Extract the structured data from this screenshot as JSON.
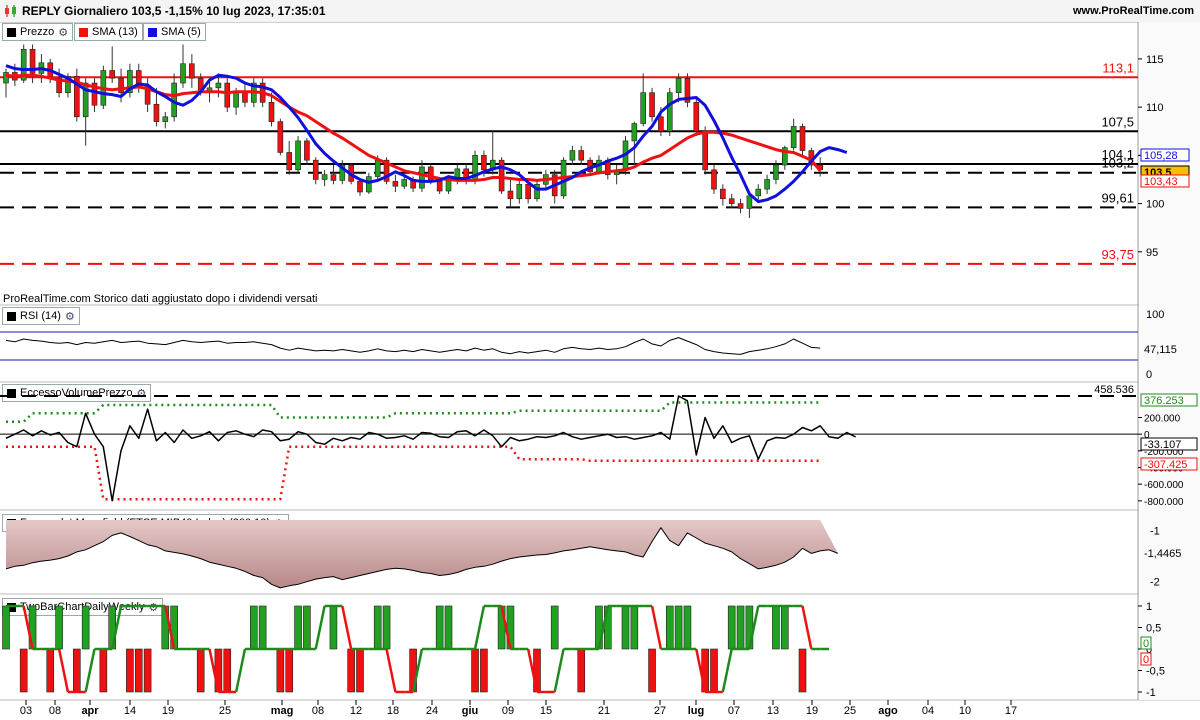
{
  "header": {
    "title": "REPLY Giornaliero 103,5 -1,15% 10 lug 2023, 17:35:01",
    "brand": "www.ProRealTime.com"
  },
  "legend": {
    "price": "Prezzo",
    "sma13": "SMA (13)",
    "sma5": "SMA (5)",
    "rsi": "RSI (14)",
    "evp": "EccessoVolumePrezzo",
    "mansfield": "Forza relat Mansfield (FTSE MIB40 Index) (200 10)",
    "twobar": "TwoBarChartDailyWeekly"
  },
  "note": "ProRealTime.com  Storico dati aggiustato dopo i dividendi versati",
  "colors": {
    "up": "#22a022",
    "down": "#ee1111",
    "sma13": "#ee1111",
    "sma5": "#1010dd",
    "line": "#000000",
    "green_dots": "#1e8a1e",
    "red_dots": "#ee1111",
    "fill": "#d8b0b0"
  },
  "x_axis": {
    "labels": [
      "03",
      "08",
      "apr",
      "14",
      "19",
      "25",
      "mag",
      "08",
      "12",
      "18",
      "24",
      "giu",
      "09",
      "15",
      "21",
      "27",
      "lug",
      "07",
      "13",
      "19",
      "25",
      "ago",
      "04",
      "10",
      "17"
    ],
    "bold": [
      "apr",
      "mag",
      "giu",
      "lug",
      "ago"
    ]
  },
  "price_panel": {
    "ticks": [
      "115",
      "110",
      "105",
      "100",
      "95"
    ],
    "levels": [
      {
        "label": "113,1",
        "value": 113.1,
        "style": "red-solid"
      },
      {
        "label": "107,5",
        "value": 107.5,
        "style": "black-solid"
      },
      {
        "label": "104,1",
        "value": 104.1,
        "style": "black-solid"
      },
      {
        "label": "103,2",
        "value": 103.2,
        "style": "black-dashed"
      },
      {
        "label": "99,61",
        "value": 99.61,
        "style": "black-dashed"
      },
      {
        "label": "93,75",
        "value": 93.75,
        "style": "red-dashed"
      }
    ],
    "badges": [
      {
        "label": "105,28",
        "color": "#1010dd"
      },
      {
        "label": "103,5",
        "color": "#000000"
      },
      {
        "label": "103,43",
        "color": "#ee1111"
      }
    ]
  },
  "rsi_panel": {
    "ticks": [
      "100",
      "0"
    ],
    "value": "47,115"
  },
  "evp_panel": {
    "ticks": [
      "200.000",
      "0",
      "-200.000",
      "-400.000",
      "-600.000",
      "-800.000"
    ],
    "level": "458.536",
    "badges": [
      {
        "label": "376.253",
        "color": "#1e8a1e"
      },
      {
        "label": "-33.107",
        "color": "#000000"
      },
      {
        "label": "-307.425",
        "color": "#ee1111"
      }
    ]
  },
  "mansfield_panel": {
    "ticks": [
      "-1",
      "-2"
    ],
    "value": "-1,4465"
  },
  "twobar_panel": {
    "ticks": [
      "1",
      "0,5",
      "0",
      "-0,5",
      "-1"
    ],
    "badges": [
      {
        "label": "0",
        "color": "#1e8a1e"
      },
      {
        "label": "0",
        "color": "#ee1111"
      }
    ]
  },
  "chart_data": {
    "type": "line",
    "title": "REPLY Giornaliero",
    "ylim": [
      90,
      118
    ],
    "candles": [
      [
        112.5,
        114.0,
        111.0,
        113.6
      ],
      [
        113.6,
        114.5,
        112.2,
        112.8
      ],
      [
        112.8,
        116.5,
        112.5,
        116.0
      ],
      [
        116.0,
        116.5,
        112.5,
        113.5
      ],
      [
        113.5,
        115.5,
        112.5,
        114.6
      ],
      [
        114.6,
        115.0,
        112.5,
        113.0
      ],
      [
        113.0,
        114.0,
        111.0,
        111.5
      ],
      [
        111.5,
        113.5,
        111.0,
        113.2
      ],
      [
        113.2,
        114.0,
        108.5,
        109.0
      ],
      [
        109.0,
        113.0,
        106.0,
        112.5
      ],
      [
        112.5,
        113.0,
        109.5,
        110.2
      ],
      [
        110.2,
        114.3,
        109.8,
        113.8
      ],
      [
        113.8,
        116.3,
        112.5,
        113.0
      ],
      [
        113.0,
        114.0,
        110.5,
        111.5
      ],
      [
        111.5,
        114.5,
        111.0,
        113.8
      ],
      [
        113.8,
        114.5,
        111.5,
        112.2
      ],
      [
        112.2,
        113.0,
        109.5,
        110.3
      ],
      [
        110.3,
        112.0,
        108.0,
        108.5
      ],
      [
        108.5,
        109.5,
        107.8,
        109.0
      ],
      [
        109.0,
        113.5,
        108.5,
        112.5
      ],
      [
        112.5,
        116.5,
        112.0,
        114.5
      ],
      [
        114.5,
        115.5,
        112.0,
        113.0
      ],
      [
        113.0,
        113.5,
        111.2,
        111.6
      ],
      [
        111.6,
        113.0,
        110.5,
        112.0
      ],
      [
        112.0,
        113.5,
        111.0,
        112.5
      ],
      [
        112.5,
        113.0,
        109.5,
        110.0
      ],
      [
        110.0,
        112.0,
        109.2,
        111.6
      ],
      [
        111.6,
        112.5,
        110.0,
        110.5
      ],
      [
        110.5,
        113.0,
        110.0,
        112.5
      ],
      [
        112.5,
        113.0,
        110.0,
        110.5
      ],
      [
        110.5,
        111.5,
        108.0,
        108.5
      ],
      [
        108.5,
        108.8,
        105.0,
        105.3
      ],
      [
        105.3,
        106.5,
        103.0,
        103.5
      ],
      [
        103.5,
        107.0,
        103.2,
        106.5
      ],
      [
        106.5,
        106.8,
        104.0,
        104.5
      ],
      [
        104.5,
        104.8,
        102.0,
        102.5
      ],
      [
        102.5,
        103.5,
        101.8,
        103.0
      ],
      [
        103.0,
        104.0,
        102.0,
        102.4
      ],
      [
        102.4,
        104.5,
        102.0,
        104.0
      ],
      [
        104.0,
        104.2,
        102.0,
        102.3
      ],
      [
        102.3,
        102.5,
        100.8,
        101.2
      ],
      [
        101.2,
        103.2,
        101.0,
        102.8
      ],
      [
        102.8,
        105.0,
        102.5,
        104.5
      ],
      [
        104.5,
        104.8,
        102.0,
        102.3
      ],
      [
        102.3,
        103.0,
        101.2,
        101.8
      ],
      [
        101.8,
        103.0,
        101.5,
        102.5
      ],
      [
        102.5,
        102.8,
        101.2,
        101.6
      ],
      [
        101.6,
        104.5,
        101.2,
        103.8
      ],
      [
        103.8,
        104.0,
        102.0,
        102.3
      ],
      [
        102.3,
        102.6,
        101.0,
        101.3
      ],
      [
        101.3,
        102.8,
        101.0,
        102.5
      ],
      [
        102.5,
        104.0,
        102.0,
        103.6
      ],
      [
        103.6,
        104.2,
        102.0,
        102.5
      ],
      [
        102.5,
        105.5,
        102.0,
        105.0
      ],
      [
        105.0,
        105.5,
        102.8,
        103.5
      ],
      [
        103.5,
        107.5,
        103.0,
        104.5
      ],
      [
        104.5,
        104.8,
        101.0,
        101.3
      ],
      [
        101.3,
        102.5,
        99.6,
        100.5
      ],
      [
        100.5,
        102.5,
        100.0,
        102.0
      ],
      [
        102.0,
        102.5,
        100.0,
        100.5
      ],
      [
        100.5,
        102.5,
        100.2,
        102.0
      ],
      [
        102.0,
        103.5,
        101.5,
        103.0
      ],
      [
        103.0,
        103.5,
        100.0,
        100.8
      ],
      [
        100.8,
        104.8,
        100.5,
        104.5
      ],
      [
        104.5,
        106.0,
        104.0,
        105.5
      ],
      [
        105.5,
        106.0,
        104.0,
        104.5
      ],
      [
        104.5,
        104.8,
        103.0,
        103.3
      ],
      [
        103.3,
        105.0,
        103.0,
        104.5
      ],
      [
        104.5,
        104.8,
        102.5,
        103.0
      ],
      [
        103.0,
        104.0,
        102.0,
        103.5
      ],
      [
        103.5,
        107.0,
        103.0,
        106.5
      ],
      [
        106.5,
        108.5,
        104.0,
        108.3
      ],
      [
        108.3,
        113.5,
        108.0,
        111.5
      ],
      [
        111.5,
        112.0,
        108.5,
        109.0
      ],
      [
        109.0,
        110.0,
        107.0,
        107.5
      ],
      [
        107.5,
        112.0,
        107.0,
        111.5
      ],
      [
        111.5,
        113.5,
        110.5,
        113.0
      ],
      [
        113.0,
        113.5,
        110.0,
        110.5
      ],
      [
        110.5,
        111.0,
        107.0,
        107.5
      ],
      [
        107.5,
        108.0,
        103.0,
        103.5
      ],
      [
        103.5,
        104.0,
        101.0,
        101.5
      ],
      [
        101.5,
        102.0,
        99.8,
        100.5
      ],
      [
        100.5,
        101.0,
        99.5,
        100.0
      ],
      [
        100.0,
        100.5,
        99.0,
        99.5
      ],
      [
        99.5,
        101.0,
        98.5,
        100.8
      ],
      [
        100.8,
        102.0,
        100.2,
        101.5
      ],
      [
        101.5,
        103.0,
        101.0,
        102.5
      ],
      [
        102.5,
        104.5,
        102.0,
        104.0
      ],
      [
        104.0,
        106.0,
        103.5,
        105.8
      ],
      [
        105.8,
        108.8,
        105.5,
        108.0
      ],
      [
        108.0,
        108.3,
        105.0,
        105.5
      ],
      [
        105.5,
        105.8,
        103.5,
        104.0
      ],
      [
        104.0,
        104.8,
        102.8,
        103.5
      ]
    ],
    "sma13": [
      113.3,
      113.2,
      113.3,
      113.3,
      113.2,
      113.0,
      112.8,
      112.7,
      112.6,
      112.3,
      112.1,
      111.9,
      111.8,
      111.9,
      112.0,
      112.1,
      111.9,
      111.6,
      111.3,
      111.2,
      111.4,
      111.5,
      111.6,
      111.6,
      111.6,
      111.5,
      111.6,
      111.6,
      111.6,
      111.5,
      111.2,
      110.6,
      110.0,
      109.5,
      109.1,
      108.5,
      107.9,
      107.3,
      106.8,
      106.2,
      105.6,
      105.0,
      104.6,
      104.2,
      103.8,
      103.4,
      103.2,
      103.0,
      102.8,
      102.6,
      102.5,
      102.4,
      102.4,
      102.4,
      102.5,
      102.7,
      102.7,
      102.6,
      102.5,
      102.5,
      102.4,
      102.5,
      102.6,
      102.7,
      102.8,
      102.9,
      103.0,
      103.2,
      103.3,
      103.4,
      103.5,
      103.8,
      104.3,
      104.7,
      105.0,
      105.6,
      106.2,
      106.8,
      107.2,
      107.4,
      107.4,
      107.3,
      107.1,
      106.8,
      106.5,
      106.2,
      105.9,
      105.6,
      105.4,
      105.3,
      104.9,
      104.5,
      103.4
    ],
    "sma5": [
      114.3,
      114.0,
      113.9,
      113.9,
      114.0,
      113.8,
      113.4,
      113.0,
      112.4,
      111.8,
      111.6,
      111.4,
      111.3,
      111.1,
      111.9,
      112.4,
      112.3,
      111.6,
      111.1,
      110.5,
      110.2,
      110.7,
      111.6,
      112.8,
      113.3,
      113.2,
      113.0,
      112.5,
      112.2,
      112.1,
      111.8,
      111.0,
      110.0,
      108.9,
      107.6,
      106.2,
      105.2,
      104.4,
      103.7,
      103.0,
      102.5,
      102.2,
      102.4,
      102.8,
      103.3,
      102.9,
      102.4,
      102.3,
      102.3,
      102.4,
      102.8,
      102.6,
      102.6,
      102.9,
      103.3,
      103.6,
      103.8,
      103.5,
      103.0,
      102.2,
      101.5,
      101.5,
      101.9,
      102.3,
      102.7,
      103.3,
      103.7,
      104.0,
      104.4,
      104.7,
      105.1,
      105.8,
      107.0,
      108.0,
      109.5,
      110.3,
      110.8,
      110.9,
      111.0,
      110.2,
      108.6,
      106.8,
      104.8,
      103.0,
      101.0,
      100.2,
      100.4,
      100.8,
      101.5,
      102.3,
      103.3,
      104.4,
      105.4,
      105.8,
      105.6,
      105.3
    ],
    "rsi": [
      58,
      56,
      60,
      58,
      57,
      55,
      54,
      55,
      52,
      55,
      54,
      56,
      58,
      55,
      56,
      57,
      54,
      53,
      52,
      55,
      58,
      56,
      55,
      56,
      57,
      54,
      55,
      55,
      56,
      54,
      52,
      47,
      44,
      47,
      45,
      43,
      44,
      43,
      45,
      43,
      41,
      43,
      46,
      43,
      42,
      44,
      42,
      45,
      43,
      41,
      43,
      45,
      43,
      47,
      44,
      46,
      41,
      39,
      42,
      40,
      42,
      44,
      41,
      46,
      48,
      46,
      45,
      47,
      45,
      46,
      49,
      55,
      60,
      53,
      50,
      58,
      62,
      57,
      52,
      45,
      42,
      40,
      39,
      38,
      42,
      44,
      46,
      49,
      53,
      60,
      54,
      48,
      47
    ],
    "evp": [
      -50000,
      0,
      50000,
      -20000,
      40000,
      -10000,
      20000,
      -100000,
      -150000,
      250000,
      0,
      -150000,
      -800000,
      -200000,
      100000,
      -50000,
      300000,
      -80000,
      20000,
      -100000,
      50000,
      -50000,
      -20000,
      30000,
      -80000,
      20000,
      40000,
      0,
      -30000,
      50000,
      30000,
      -80000,
      -60000,
      30000,
      0,
      -100000,
      -120000,
      -50000,
      -80000,
      -40000,
      -60000,
      20000,
      0,
      -50000,
      -40000,
      -20000,
      -60000,
      20000,
      10000,
      -30000,
      -40000,
      30000,
      40000,
      -20000,
      50000,
      -20000,
      -150000,
      -40000,
      -80000,
      -60000,
      -30000,
      -40000,
      -20000,
      20000,
      -30000,
      -60000,
      -40000,
      -20000,
      0,
      -40000,
      -30000,
      -60000,
      -40000,
      -20000,
      20000,
      -60000,
      458536,
      400000,
      -250000,
      200000,
      -50000,
      100000,
      -100000,
      -50000,
      -20000,
      -300000,
      -80000,
      -40000,
      -50000,
      0,
      80000,
      40000,
      100000,
      -30000,
      -50000,
      20000,
      -33107
    ],
    "mansfield": [
      -1.75,
      -1.7,
      -1.68,
      -1.63,
      -1.6,
      -1.58,
      -1.55,
      -1.5,
      -1.42,
      -1.38,
      -1.3,
      -1.22,
      -1.1,
      -1.05,
      -1.12,
      -1.2,
      -1.28,
      -1.32,
      -1.4,
      -1.43,
      -1.46,
      -1.5,
      -1.55,
      -1.62,
      -1.66,
      -1.7,
      -1.74,
      -1.8,
      -1.88,
      -1.92,
      -2.05,
      -2.12,
      -2.08,
      -2.05,
      -2.0,
      -1.95,
      -1.92,
      -1.9,
      -1.96,
      -1.92,
      -1.88,
      -1.84,
      -1.8,
      -1.76,
      -1.74,
      -1.75,
      -1.78,
      -1.82,
      -1.84,
      -1.88,
      -1.86,
      -1.82,
      -1.76,
      -1.72,
      -1.7,
      -1.66,
      -1.6,
      -1.55,
      -1.52,
      -1.5,
      -1.48,
      -1.47,
      -1.44,
      -1.4,
      -1.38,
      -1.35,
      -1.32,
      -1.35,
      -1.38,
      -1.4,
      -1.42,
      -1.48,
      -1.52,
      -1.22,
      -0.95,
      -1.2,
      -1.3,
      -1.05,
      -1.15,
      -1.25,
      -1.3,
      -1.35,
      -1.42,
      -1.55,
      -1.65,
      -1.75,
      -1.72,
      -1.68,
      -1.62,
      -1.52,
      -1.35,
      -1.45,
      -1.4,
      -1.38,
      -1.45
    ],
    "twobar_line": [
      1,
      1,
      1,
      0,
      0,
      0,
      0,
      -1,
      -1,
      -1,
      0,
      0,
      0,
      1,
      1,
      1,
      1,
      1,
      1,
      0,
      0,
      0,
      0,
      0,
      -1,
      -1,
      -1,
      0,
      0,
      0,
      0,
      0,
      0,
      0,
      0,
      0,
      1,
      1,
      1,
      0,
      0,
      0,
      0,
      0,
      -1,
      -1,
      -1,
      0,
      0,
      0,
      0,
      0,
      0,
      0,
      1,
      1,
      1,
      0,
      0,
      0,
      -1,
      -1,
      -1,
      0,
      0,
      0,
      0,
      0,
      1,
      1,
      1,
      1,
      1,
      1,
      0,
      0,
      0,
      0,
      0,
      -1,
      -1,
      -1,
      0,
      0,
      0,
      1,
      1,
      1,
      1,
      1,
      1,
      0,
      0,
      0
    ],
    "twobar_bars": [
      1,
      0,
      -1,
      1,
      0,
      -1,
      1,
      0,
      -1,
      1,
      0,
      -1,
      1,
      0,
      -1,
      -1,
      -1,
      0,
      1,
      1,
      0,
      0,
      -1,
      0,
      -1,
      -1,
      0,
      0,
      1,
      1,
      0,
      -1,
      -1,
      1,
      1,
      0,
      0,
      1,
      0,
      -1,
      -1,
      0,
      1,
      1,
      0,
      0,
      -1,
      0,
      0,
      1,
      1,
      0,
      0,
      -1,
      -1,
      0,
      1,
      1,
      0,
      0,
      -1,
      0,
      1,
      0,
      0,
      -1,
      0,
      1,
      1,
      0,
      1,
      1,
      0,
      -1,
      0,
      1,
      1,
      1,
      0,
      -1,
      -1,
      0,
      1,
      1,
      1,
      0,
      0,
      1,
      1,
      0,
      -1,
      0,
      0
    ]
  }
}
